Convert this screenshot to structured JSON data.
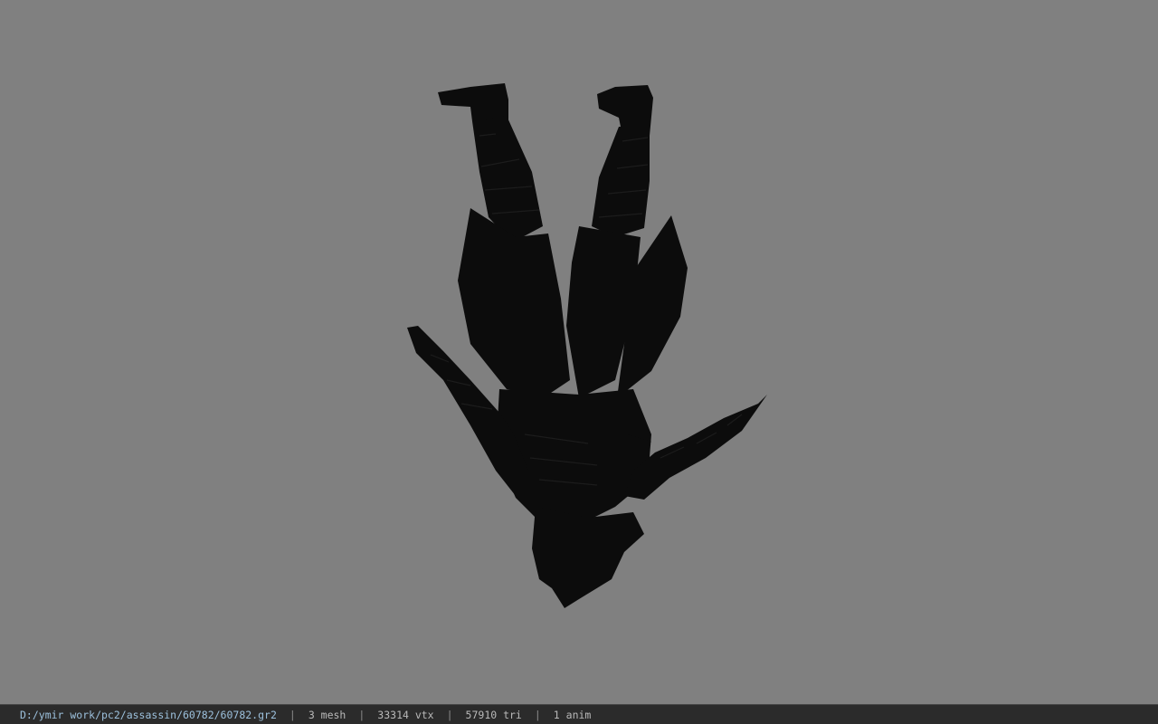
{
  "viewport": {
    "background_color": "#808080",
    "model_color": "#0c0c0c"
  },
  "status_bar": {
    "file_path": "D:/ymir work/pc2/assassin/60782/60782.gr2",
    "separator": "|",
    "mesh_count": "3 mesh",
    "vertex_count": "33314 vtx",
    "triangle_count": "57910 tri",
    "animation_count": "1 anim"
  }
}
